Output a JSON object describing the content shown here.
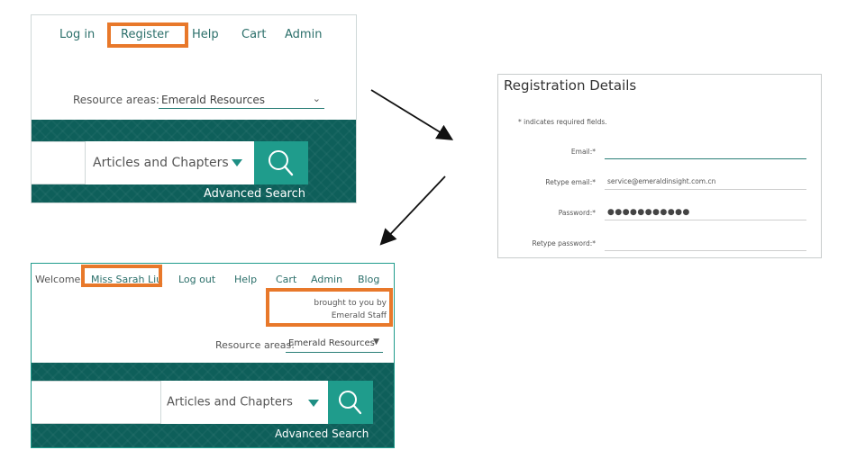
{
  "panel1": {
    "nav": {
      "login": "Log in",
      "register": "Register",
      "help": "Help",
      "cart": "Cart",
      "admin": "Admin"
    },
    "resource_areas_label": "Resource areas:",
    "resource_areas_value": "Emerald Resources",
    "search_type": "Articles and Chapters",
    "advanced_search": "Advanced Search"
  },
  "panel2": {
    "title": "Registration Details",
    "required_note": "* indicates required fields.",
    "fields": [
      {
        "label": "Email:*",
        "value": ""
      },
      {
        "label": "Retype email:*",
        "value": "service@emeraldinsight.com.cn"
      },
      {
        "label": "Password:*",
        "value": "●●●●●●●●●●●"
      },
      {
        "label": "Retype password:*",
        "value": ""
      }
    ]
  },
  "panel3": {
    "welcome": "Welcome:",
    "username": "Miss Sarah Liu",
    "nav": {
      "logout": "Log out",
      "help": "Help",
      "cart": "Cart",
      "admin": "Admin",
      "blog": "Blog"
    },
    "brought_line1": "brought to you by",
    "brought_line2": "Emerald Staff",
    "resource_areas_label": "Resource areas:",
    "resource_areas_value": "Emerald Resources",
    "search_type": "Articles and Chapters",
    "advanced_search": "Advanced Search"
  },
  "colors": {
    "highlight": "#e8782a",
    "teal_dark": "#0e5f5a",
    "teal_button": "#1f9c8c",
    "link": "#2b6f6a"
  }
}
